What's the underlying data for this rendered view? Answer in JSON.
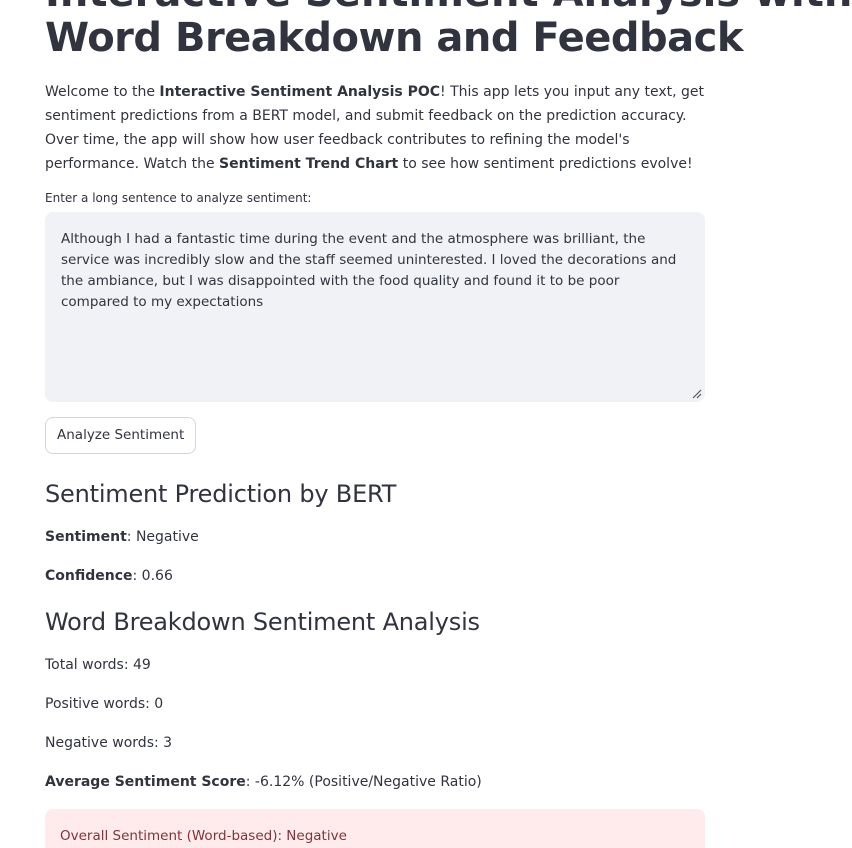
{
  "header": {
    "title_line1": "Interactive Sentiment Analysis with",
    "title_line2": "Word Breakdown and Feedback"
  },
  "intro": {
    "part1": "Welcome to the ",
    "bold1": "Interactive Sentiment Analysis POC",
    "part2": "! This app lets you input any text, get sentiment predictions from a BERT model, and submit feedback on the prediction accuracy. Over time, the app will show how user feedback contributes to refining the model's performance. Watch the ",
    "bold2": "Sentiment Trend Chart",
    "part3": " to see how sentiment predictions evolve!"
  },
  "input": {
    "label": "Enter a long sentence to analyze sentiment:",
    "value": "Although I had a fantastic time during the event and the atmosphere was brilliant, the service was incredibly slow and the staff seemed uninterested. I loved the decorations and the ambiance, but I was disappointed with the food quality and found it to be poor compared to my expectations"
  },
  "analyze_button": {
    "label": "Analyze Sentiment"
  },
  "prediction": {
    "heading": "Sentiment Prediction by BERT",
    "sentiment_label": "Sentiment",
    "sentiment_value": ": Negative",
    "confidence_label": "Confidence",
    "confidence_value": ": 0.66"
  },
  "breakdown": {
    "heading": "Word Breakdown Sentiment Analysis",
    "total_words": "Total words: 49",
    "positive_words": "Positive words: 0",
    "negative_words": "Negative words: 3",
    "avg_label": "Average Sentiment Score",
    "avg_value": ": -6.12% (Positive/Negative Ratio)",
    "overall": "Overall Sentiment (Word-based): Negative"
  },
  "colors": {
    "text": "#31333f",
    "input_bg": "#f0f2f6",
    "error_bg": "#ffebeb",
    "error_text": "#7d353b"
  }
}
